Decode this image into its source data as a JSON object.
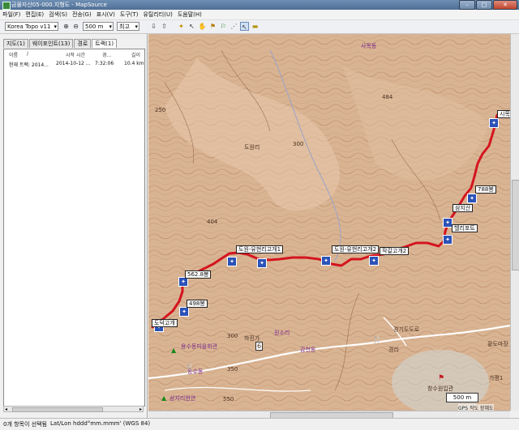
{
  "window": {
    "title": "금물자산05-000.지형도 - MapSource"
  },
  "menu": [
    "파일(F)",
    "편집(E)",
    "검색(S)",
    "전송(G)",
    "표시(V)",
    "도구(T)",
    "유틸리티(U)",
    "도움말(H)"
  ],
  "toolbar": {
    "map_product": "Korea Topo v11",
    "zoom_level": "500 m",
    "detail": "최고"
  },
  "left_panel": {
    "tabs": [
      "지도(1)",
      "웨이포인트(13)",
      "경로",
      "트랙(1)"
    ],
    "selected_tab": 3,
    "columns": [
      "이름",
      "/",
      "시작 시간",
      "경...",
      "길이"
    ],
    "rows": [
      {
        "name": "현재 트랙: 2014...",
        "start": "2014-10-12 ...",
        "duration": "7:32:06",
        "length": "10.4 km"
      }
    ]
  },
  "map": {
    "waypoints": [
      "도원-유현리고개1",
      "도원-유현리고개2",
      "작갈고개2",
      "562.8봉",
      "498봉",
      "도덕고개",
      "헬리포트",
      "삼지산",
      "788봉",
      "시목"
    ],
    "labels": {
      "elev_250": "250",
      "elev_300a": "300",
      "elev_300b": "300",
      "elev_404": "404",
      "elev_484": "484",
      "elev_550": "550",
      "elev_350": "350",
      "village_a": "도원리",
      "poi_a": "사목동",
      "poi_b": "용수동마을회관",
      "poi_c": "감천동",
      "poi_d": "경리",
      "poi_e": "황도마장",
      "poi_f": "하진가",
      "poi_g": "창수원입관",
      "poi_h": "원소리",
      "road_a": "경기도도로",
      "poi_i": "용수동",
      "poi_j": "삼지리현연",
      "poi_k": "가평1"
    },
    "scale": "500 m",
    "gps_note": "GPS 작도 장혜도"
  },
  "status": {
    "selection": "0개 항목이 선택됨",
    "coords": "Lat/Lon hddd°mm.mmm' (WGS 84)"
  },
  "colors": {
    "track": "#d4141e",
    "terrain": "#d7b08f",
    "contour": "#a87452",
    "waypoint_icon": "#2b52b8"
  }
}
